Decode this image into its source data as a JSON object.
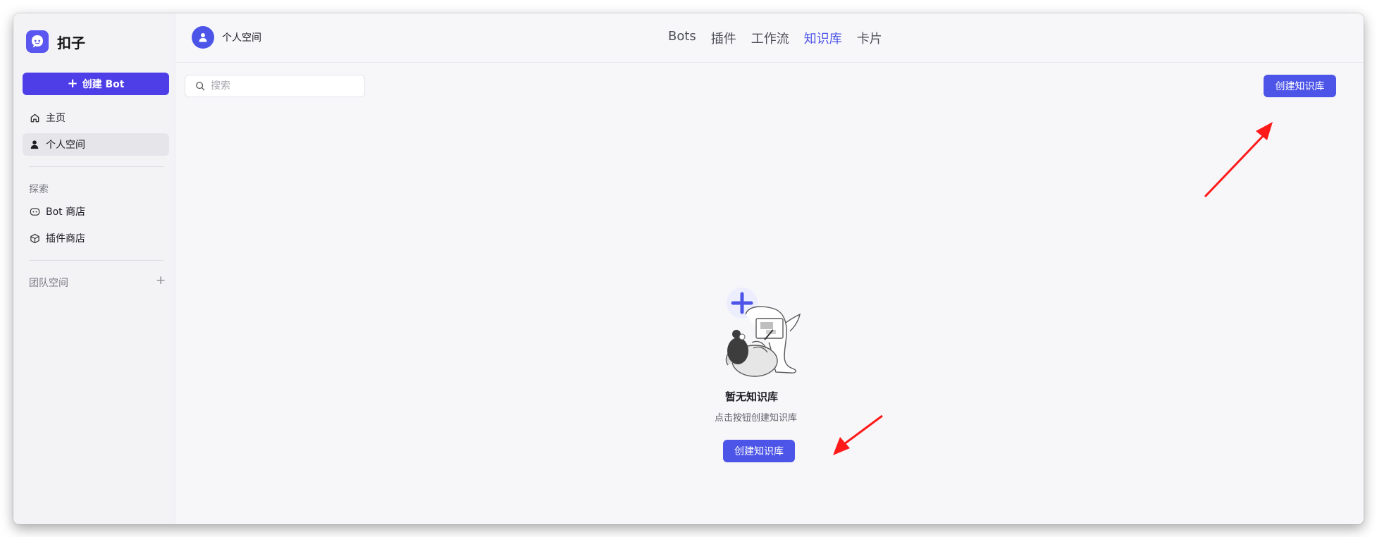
{
  "brand": {
    "name": "扣子"
  },
  "sidebar": {
    "create_bot_label": "创建 Bot",
    "items": [
      {
        "label": "主页",
        "icon": "home-icon"
      },
      {
        "label": "个人空间",
        "icon": "user-icon",
        "active": true
      }
    ],
    "explore_label": "探索",
    "explore_items": [
      {
        "label": "Bot 商店",
        "icon": "bot-icon"
      },
      {
        "label": "插件商店",
        "icon": "cube-icon"
      }
    ],
    "team_label": "团队空间"
  },
  "header": {
    "workspace_name": "个人空间",
    "tabs": [
      {
        "label": "Bots"
      },
      {
        "label": "插件"
      },
      {
        "label": "工作流"
      },
      {
        "label": "知识库",
        "active": true
      },
      {
        "label": "卡片"
      }
    ]
  },
  "main": {
    "search_placeholder": "搜索",
    "create_kb_label": "创建知识库",
    "empty_title": "暂无知识库",
    "empty_subtitle": "点击按钮创建知识库",
    "empty_button_label": "创建知识库"
  },
  "colors": {
    "accent": "#4d55e8",
    "create_bot": "#4d3ee8",
    "annotation_arrow": "#ff1a1a"
  }
}
